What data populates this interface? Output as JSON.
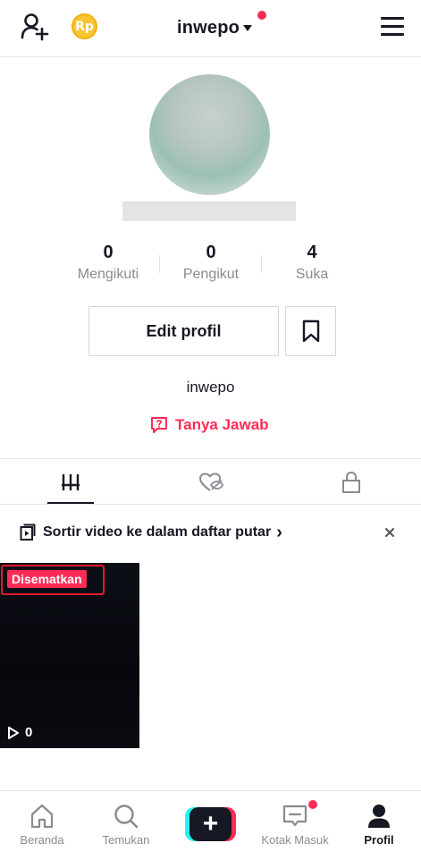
{
  "header": {
    "coin_label": "Rp",
    "account_name": "inwepo"
  },
  "profile": {
    "stats": [
      {
        "value": "0",
        "label": "Mengikuti"
      },
      {
        "value": "0",
        "label": "Pengikut"
      },
      {
        "value": "4",
        "label": "Suka"
      }
    ],
    "edit_button": "Edit profil",
    "bio": "inwepo",
    "qa_label": "Tanya Jawab"
  },
  "playlist_prompt": {
    "text": "Sortir video ke dalam daftar putar",
    "arrow": "›"
  },
  "videos": [
    {
      "pinned_badge": "Disematkan",
      "views": "0"
    }
  ],
  "nav": {
    "home": "Beranda",
    "discover": "Temukan",
    "create": "+",
    "inbox": "Kotak Masuk",
    "profile": "Profil"
  },
  "colors": {
    "accent": "#fe2c55",
    "coin": "#f6c531",
    "text": "#161823",
    "muted": "#8a8b91"
  }
}
